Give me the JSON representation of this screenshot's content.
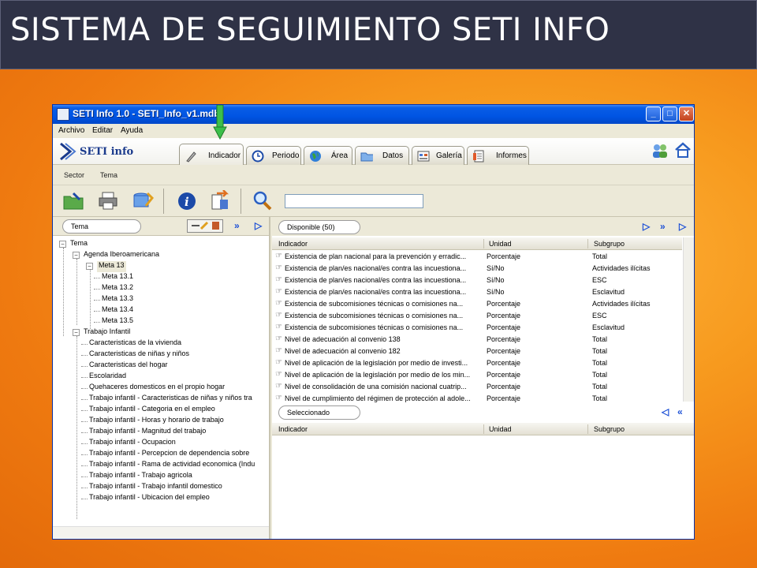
{
  "slide": {
    "title": "SISTEMA DE SEGUIMIENTO SETI INFO"
  },
  "window": {
    "title": "SETI Info 1.0 - SETI_Info_v1.mdb",
    "menu": [
      "Archivo",
      "Editar",
      "Ayuda"
    ],
    "logo_text": "SETI info"
  },
  "tabs": [
    {
      "label": "Indicador",
      "icon": "pen-icon"
    },
    {
      "label": "Periodo",
      "icon": "clock-icon"
    },
    {
      "label": "Área",
      "icon": "globe-icon"
    },
    {
      "label": "Datos",
      "icon": "folder-icon"
    },
    {
      "label": "Galería",
      "icon": "gallery-icon"
    },
    {
      "label": "Informes",
      "icon": "report-icon"
    }
  ],
  "subnav": {
    "sector": "Sector",
    "tema": "Tema"
  },
  "left_panel": {
    "pill": "Tema",
    "tree": [
      {
        "label": "Tema",
        "level": 0,
        "exp": "−"
      },
      {
        "label": "Agenda Iberoamericana",
        "level": 1,
        "exp": "−"
      },
      {
        "label": "Meta 13",
        "level": 2,
        "exp": "−",
        "selected": true
      },
      {
        "label": "Meta 13.1",
        "level": 3
      },
      {
        "label": "Meta 13.2",
        "level": 3
      },
      {
        "label": "Meta 13.3",
        "level": 3
      },
      {
        "label": "Meta 13.4",
        "level": 3
      },
      {
        "label": "Meta 13.5",
        "level": 3
      },
      {
        "label": "Trabajo Infantil",
        "level": 1,
        "exp": "−"
      },
      {
        "label": "Caracteristicas de la vivienda",
        "level": 2
      },
      {
        "label": "Caracteristicas de niñas y niños",
        "level": 2
      },
      {
        "label": "Caracteristicas del hogar",
        "level": 2
      },
      {
        "label": "Escolaridad",
        "level": 2
      },
      {
        "label": "Quehaceres domesticos en el propio hogar",
        "level": 2
      },
      {
        "label": "Trabajo infantil - Caracteristicas de niñas y niños tra",
        "level": 2
      },
      {
        "label": "Trabajo infantil - Categoria en el empleo",
        "level": 2
      },
      {
        "label": "Trabajo infantil - Horas y horario de trabajo",
        "level": 2
      },
      {
        "label": "Trabajo infantil - Magnitud del trabajo",
        "level": 2
      },
      {
        "label": "Trabajo infantil - Ocupacion",
        "level": 2
      },
      {
        "label": "Trabajo infantil - Percepcion de dependencia sobre",
        "level": 2
      },
      {
        "label": "Trabajo infantil - Rama de actividad economica (Indu",
        "level": 2
      },
      {
        "label": "Trabajo infantil - Trabajo agricola",
        "level": 2
      },
      {
        "label": "Trabajo infantil - Trabajo infantil domestico",
        "level": 2
      },
      {
        "label": "Trabajo infantil - Ubicacion del empleo",
        "level": 2
      }
    ]
  },
  "available": {
    "pill": "Disponible (50)",
    "columns": [
      "Indicador",
      "Unidad",
      "Subgrupo"
    ],
    "rows": [
      [
        "Existencia de plan nacional para la prevención y erradic...",
        "Porcentaje",
        "Total"
      ],
      [
        "Existencia de plan/es nacional/es contra las incuestiona...",
        "Sí/No",
        "Actividades ilícitas"
      ],
      [
        "Existencia de plan/es nacional/es contra las incuestiona...",
        "Sí/No",
        "ESC"
      ],
      [
        "Existencia de plan/es nacional/es contra las incuestiona...",
        "Sí/No",
        "Esclavitud"
      ],
      [
        "Existencia de subcomisiones técnicas o comisiones na...",
        "Porcentaje",
        "Actividades ilícitas"
      ],
      [
        "Existencia de subcomisiones técnicas o comisiones na...",
        "Porcentaje",
        "ESC"
      ],
      [
        "Existencia de subcomisiones técnicas o comisiones na...",
        "Porcentaje",
        "Esclavitud"
      ],
      [
        "Nivel de adecuación al convenio 138",
        "Porcentaje",
        "Total"
      ],
      [
        "Nivel de adecuación al convenio 182",
        "Porcentaje",
        "Total"
      ],
      [
        "Nivel de aplicación de la legislación por medio de investi...",
        "Porcentaje",
        "Total"
      ],
      [
        "Nivel de aplicación de la legislación por medio de los min...",
        "Porcentaje",
        "Total"
      ],
      [
        "Nivel de consolidación de una comisión nacional cuatrip...",
        "Porcentaje",
        "Total"
      ],
      [
        "Nivel de cumplimiento del régimen de protección al adole...",
        "Porcentaje",
        "Total"
      ]
    ]
  },
  "selected": {
    "pill": "Seleccionado",
    "columns": [
      "Indicador",
      "Unidad",
      "Subgrupo"
    ]
  }
}
